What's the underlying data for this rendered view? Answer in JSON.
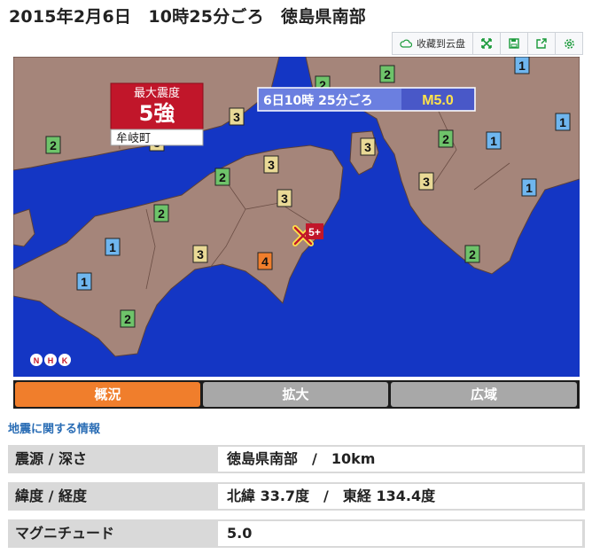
{
  "title": "2015年2月6日　10時25分ごろ　徳島県南部",
  "toolbar": {
    "save_cloud_label": "收藏到云盘",
    "icons": [
      "cloud-icon",
      "expand-icon",
      "floppy-icon",
      "share-icon",
      "gear-icon"
    ]
  },
  "map": {
    "max_intensity_label": "最大震度",
    "max_intensity_value": "5強",
    "max_intensity_place": "牟岐町",
    "event_time": "6日10時 25分ごろ",
    "magnitude": "M5.0",
    "epicenter_intensity": "5+",
    "broadcaster_logo": "NHK",
    "colors": {
      "sea": "#1436c4",
      "land": "#a5857a",
      "int1": "#6fb6ef",
      "int2": "#6ec36a",
      "int3": "#e9d996",
      "int4": "#f07e2c",
      "int5plus": "#c1162a"
    },
    "intensity_markers": [
      "1",
      "1",
      "1",
      "1",
      "2",
      "2",
      "2",
      "2",
      "2",
      "3",
      "3",
      "3",
      "3",
      "3",
      "3",
      "3",
      "4",
      "1",
      "1",
      "2",
      "2",
      "2",
      "3",
      "1",
      "2"
    ]
  },
  "tabs": [
    {
      "label": "概況",
      "active": true
    },
    {
      "label": "拡大",
      "active": false
    },
    {
      "label": "広域",
      "active": false
    }
  ],
  "section_title": "地震に関する情報",
  "info": [
    {
      "label": "震源 / 深さ",
      "value": "徳島県南部　/　10km"
    },
    {
      "label": "緯度 / 経度",
      "value": "北緯 33.7度　/　東経 134.4度"
    },
    {
      "label": "マグニチュード",
      "value": "5.0"
    }
  ]
}
